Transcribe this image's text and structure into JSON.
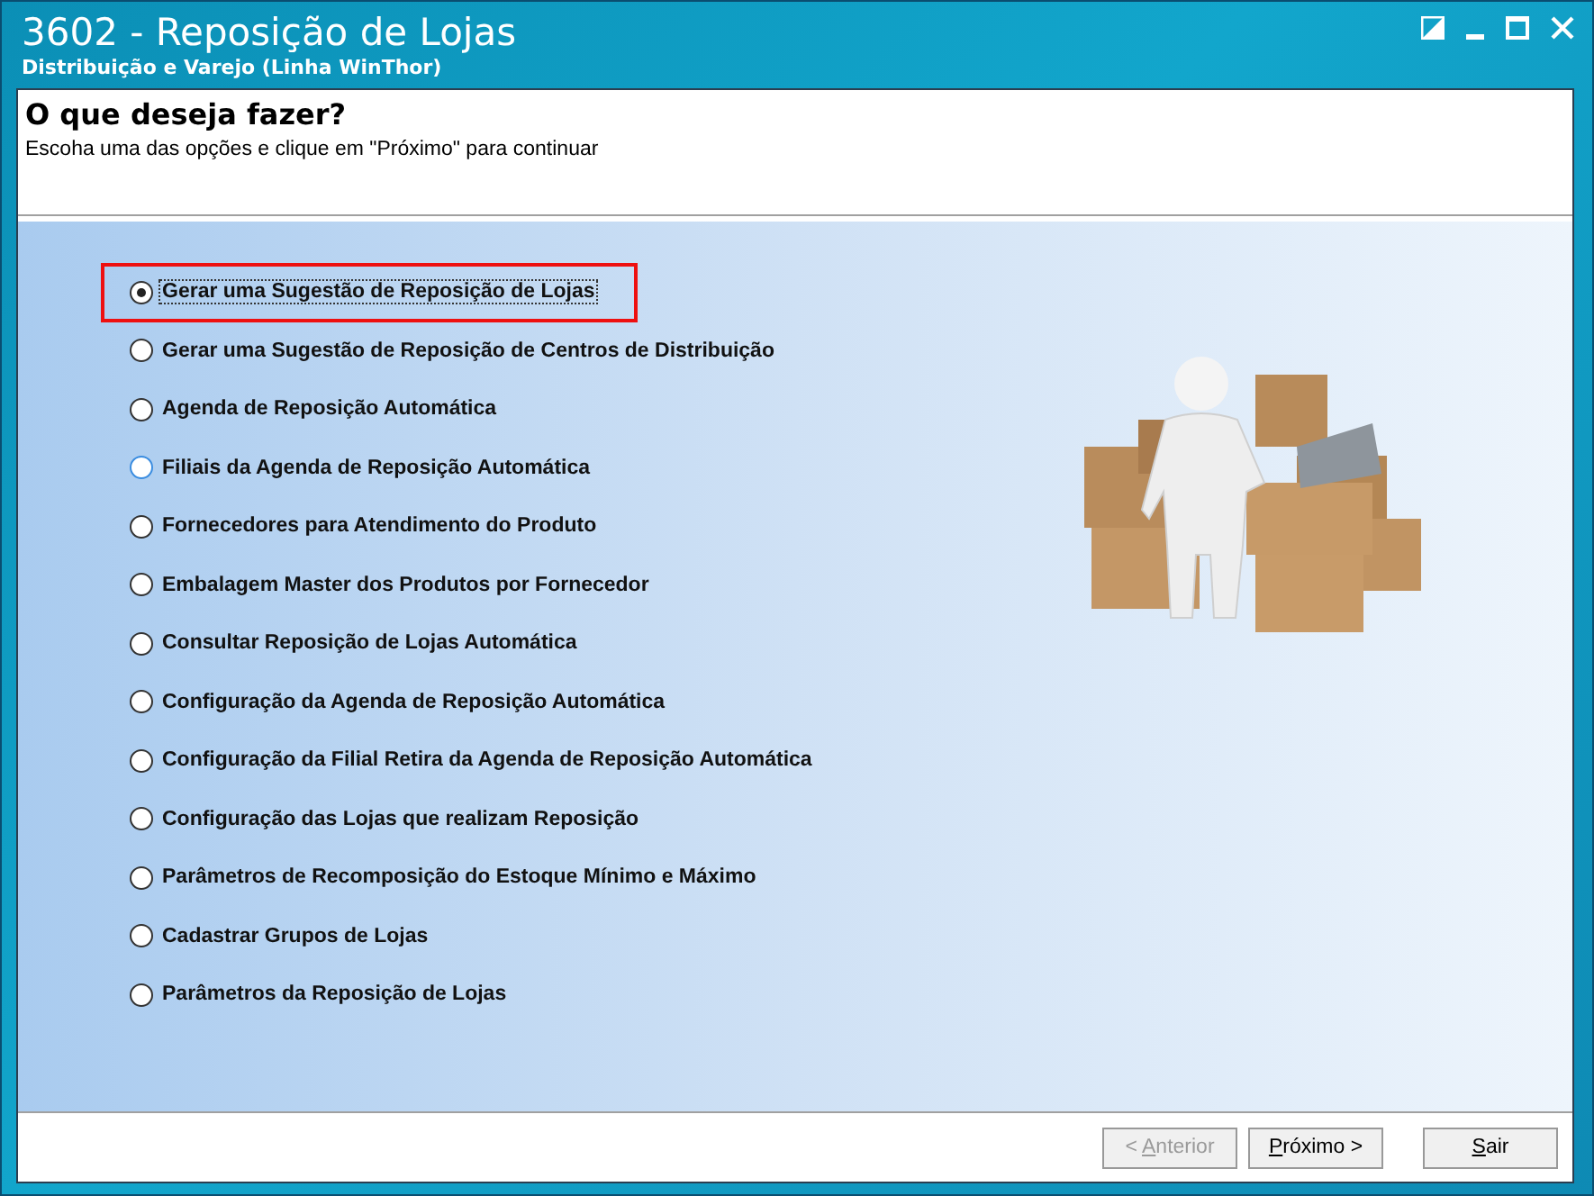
{
  "window": {
    "title": "3602 - Reposição de Lojas",
    "subtitle": "Distribuição e Varejo (Linha WinThor)"
  },
  "header": {
    "title": "O que deseja fazer?",
    "instruction": "Escoha uma das opções e clique em \"Próximo\" para continuar"
  },
  "options": [
    {
      "label": "Gerar uma Sugestão de Reposição de Lojas",
      "selected": true,
      "focused": true,
      "highlighted": true,
      "hovered": false
    },
    {
      "label": "Gerar uma Sugestão de Reposição de Centros de Distribuição",
      "selected": false,
      "focused": false,
      "highlighted": false,
      "hovered": false
    },
    {
      "label": "Agenda de Reposição Automática",
      "selected": false,
      "focused": false,
      "highlighted": false,
      "hovered": false
    },
    {
      "label": "Filiais da Agenda de Reposição Automática",
      "selected": false,
      "focused": false,
      "highlighted": false,
      "hovered": true
    },
    {
      "label": "Fornecedores para Atendimento do Produto",
      "selected": false,
      "focused": false,
      "highlighted": false,
      "hovered": false
    },
    {
      "label": "Embalagem Master dos Produtos por Fornecedor",
      "selected": false,
      "focused": false,
      "highlighted": false,
      "hovered": false
    },
    {
      "label": "Consultar Reposição de Lojas Automática",
      "selected": false,
      "focused": false,
      "highlighted": false,
      "hovered": false
    },
    {
      "label": "Configuração da Agenda de Reposição Automática",
      "selected": false,
      "focused": false,
      "highlighted": false,
      "hovered": false
    },
    {
      "label": "Configuração da Filial Retira da Agenda de Reposição Automática",
      "selected": false,
      "focused": false,
      "highlighted": false,
      "hovered": false
    },
    {
      "label": "Configuração das Lojas que realizam Reposição",
      "selected": false,
      "focused": false,
      "highlighted": false,
      "hovered": false
    },
    {
      "label": "Parâmetros de Recomposição do Estoque Mínimo e Máximo",
      "selected": false,
      "focused": false,
      "highlighted": false,
      "hovered": false
    },
    {
      "label": "Cadastrar Grupos de Lojas",
      "selected": false,
      "focused": false,
      "highlighted": false,
      "hovered": false
    },
    {
      "label": "Parâmetros da Reposição de Lojas",
      "selected": false,
      "focused": false,
      "highlighted": false,
      "hovered": false
    }
  ],
  "buttons": [
    {
      "before": "< ",
      "accel": "A",
      "after": "nterior",
      "disabled": true
    },
    {
      "accel": "P",
      "after": "róximo >",
      "disabled": false
    },
    {
      "accel": "S",
      "after": "air",
      "disabled": false
    }
  ]
}
